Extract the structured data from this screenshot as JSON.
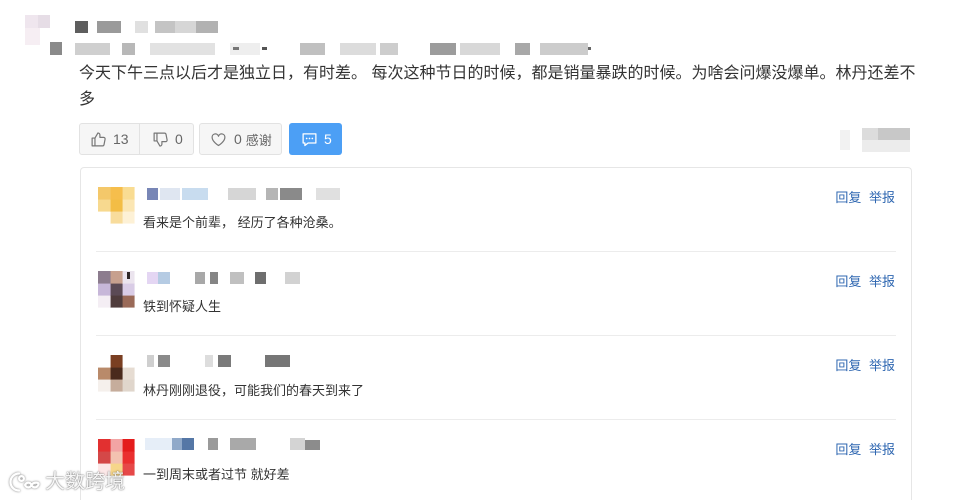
{
  "comment": {
    "text": "今天下午三点以后才是独立日，有时差。 每次这种节日的时候，都是销量暴跌的时候。为啥会问爆没爆单。林丹还差不多"
  },
  "actions": {
    "like_count": "13",
    "dislike_count": "0",
    "thanks_count": "0",
    "thanks_label": "感谢",
    "reply_count": "5"
  },
  "replies": [
    {
      "text": "看来是个前辈， 经历了各种沧桑。",
      "reply_label": "回复",
      "report_label": "举报"
    },
    {
      "text": "铁到怀疑人生",
      "reply_label": "回复",
      "report_label": "举报"
    },
    {
      "text": "林丹刚刚退役，可能我们的春天到来了",
      "reply_label": "回复",
      "report_label": "举报"
    },
    {
      "text": "一到周末或者过节 就好差",
      "reply_label": "回复",
      "report_label": "举报"
    }
  ],
  "watermark": {
    "text": "大数跨境"
  },
  "icons": {
    "like": "thumbs-up-icon",
    "dislike": "thumbs-down-icon",
    "thanks": "heart-icon",
    "reply_toggle": "comment-icon",
    "watermark_logo": "watermark-logo-icon"
  },
  "colors": {
    "accent": "#4c9ff5",
    "link": "#2f67b1",
    "text": "#333333",
    "muted": "#666666",
    "border": "#e6e6e6"
  }
}
